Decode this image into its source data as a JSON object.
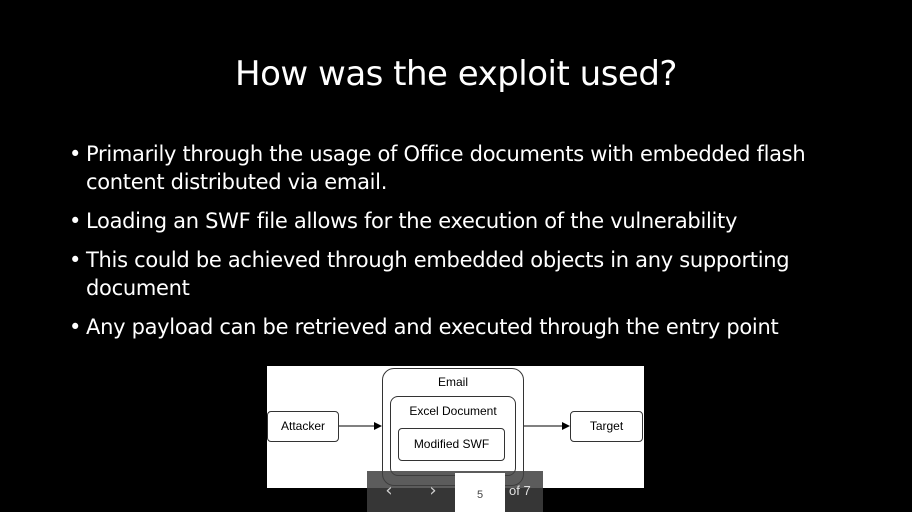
{
  "slide": {
    "title": "How was the exploit used?",
    "bullets": [
      "Primarily through the usage of Office documents with embedded flash content distributed via email.",
      "Loading an SWF file allows for the execution of the vulnerability",
      "This could be achieved through embedded objects in any supporting document",
      "Any payload can be retrieved and executed through the entry point"
    ],
    "bullet_marker": "•"
  },
  "diagram": {
    "attacker": "Attacker",
    "email": "Email",
    "excel_document": "Excel Document",
    "modified_swf": "Modified SWF",
    "target": "Target"
  },
  "pager": {
    "prev_icon": "‹",
    "next_icon": "›",
    "current_page": "5",
    "total_label": "of 7"
  },
  "colors": {
    "background": "#000000",
    "text": "#ffffff",
    "pager_bg": "#404040"
  }
}
